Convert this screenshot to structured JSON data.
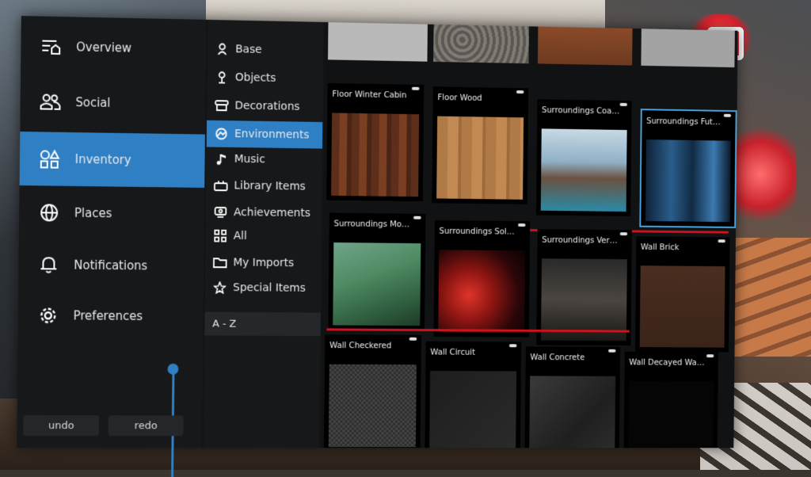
{
  "nav": {
    "items": [
      {
        "label": "Overview",
        "icon": "overview-icon"
      },
      {
        "label": "Social",
        "icon": "people-icon"
      },
      {
        "label": "Inventory",
        "icon": "shapes-icon",
        "active": true
      },
      {
        "label": "Places",
        "icon": "globe-icon"
      },
      {
        "label": "Notifications",
        "icon": "bell-icon"
      },
      {
        "label": "Preferences",
        "icon": "gear-icon"
      }
    ],
    "undo_label": "undo",
    "redo_label": "redo"
  },
  "categories": {
    "items": [
      {
        "label": "Base",
        "icon": "bust-icon"
      },
      {
        "label": "Objects",
        "icon": "lamp-icon"
      },
      {
        "label": "Decorations",
        "icon": "banner-icon"
      },
      {
        "label": "Environments",
        "icon": "landscape-icon",
        "active": true
      },
      {
        "label": "Music",
        "icon": "music-note-icon"
      },
      {
        "label": "Library Items",
        "icon": "library-icon"
      },
      {
        "label": "Achievements",
        "icon": "award-icon"
      },
      {
        "label": "All",
        "icon": "grid-icon"
      },
      {
        "label": "My Imports",
        "icon": "folder-icon"
      },
      {
        "label": "Special Items",
        "icon": "star-icon"
      }
    ],
    "sort_label": "A - Z"
  },
  "grid": {
    "tiles": [
      {
        "label": "Floor Winter Cabin",
        "texture": "wood-dark"
      },
      {
        "label": "Floor Wood",
        "texture": "wood-light"
      },
      {
        "label": "Surroundings Coas...",
        "texture": "coast"
      },
      {
        "label": "Surroundings Futu...",
        "texture": "future",
        "selected": true
      },
      {
        "label": "Surroundings Mou...",
        "texture": "mountain"
      },
      {
        "label": "Surroundings Sola...",
        "texture": "solar"
      },
      {
        "label": "Surroundings Verti...",
        "texture": "vertical"
      },
      {
        "label": "Wall Brick",
        "texture": "brick"
      },
      {
        "label": "Wall Checkered",
        "texture": "checkered"
      },
      {
        "label": "Wall Circuit",
        "texture": "circuit"
      },
      {
        "label": "Wall Concrete",
        "texture": "concrete"
      },
      {
        "label": "Wall Decayed Wall...",
        "texture": "decayed"
      }
    ]
  },
  "colors": {
    "accent": "#2f7fc4",
    "selected_outline": "#4aa6e0",
    "divider_red": "#d1121c",
    "panel_bg": "#111315"
  }
}
